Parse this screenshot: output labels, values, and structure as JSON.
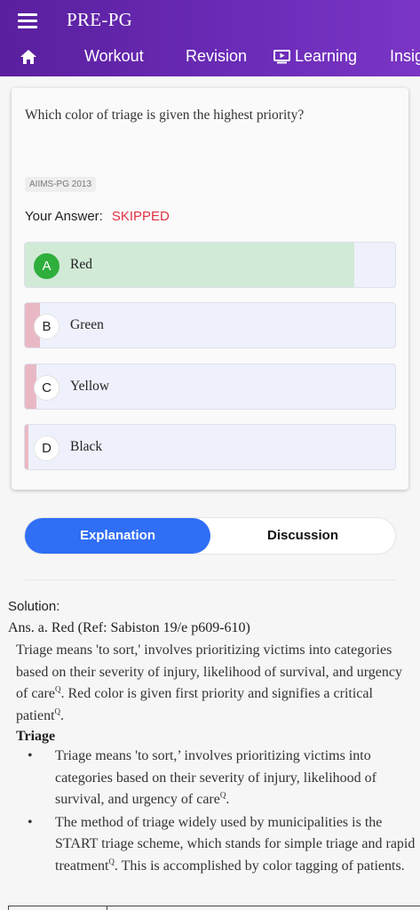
{
  "app": {
    "title": "PRE-PG"
  },
  "nav": {
    "tabs": [
      {
        "label": "Workout"
      },
      {
        "label": "Revision"
      },
      {
        "label": "Learning"
      },
      {
        "label": "Insig"
      }
    ]
  },
  "question": {
    "text": "Which color of triage is given the highest priority?",
    "tag": "AIIMS-PG 2013",
    "your_answer_label": "Your Answer:",
    "your_answer_value": "SKIPPED",
    "options": [
      {
        "letter": "A",
        "text": "Red",
        "correct": true,
        "percent": 89
      },
      {
        "letter": "B",
        "text": "Green",
        "correct": false,
        "percent": 4
      },
      {
        "letter": "C",
        "text": "Yellow",
        "correct": false,
        "percent": 3
      },
      {
        "letter": "D",
        "text": "Black",
        "correct": false,
        "percent": 1
      }
    ]
  },
  "segment": {
    "explanation": "Explanation",
    "discussion": "Discussion"
  },
  "solution": {
    "heading": "Solution:",
    "answer": "Ans. a. Red (Ref: Sabiston 19/e p609-610)",
    "para": "Triage means 'to sort,' involves prioritizing victims into categories based on their severity of injury, likelihood of survival, and urgency of care",
    "para_sup": "Q",
    "para2": ". Red color is given first priority and signifies a critical patient",
    "para2_sup": "Q",
    "para2_end": ".",
    "subheading": "Triage",
    "bullet1": "Triage means 'to sort,’ involves prioritizing victims into categories based on their severity of injury, likelihood of survival, and urgency of care",
    "bullet1_sup": "Q",
    "bullet1_end": ".",
    "bullet2": "The method of triage widely used by municipalities is the START triage scheme, which stands for simple triage and rapid treatment",
    "bullet2_sup": "Q",
    "bullet2_end": ". This is accomplished by color tagging of patients."
  },
  "colors": {
    "appbar": "#6b2cb8",
    "correct_fill": "#d1ead6",
    "wrong_fill": "#e8b9c4",
    "accent": "#2f6ef5",
    "skipped": "#e03040"
  }
}
